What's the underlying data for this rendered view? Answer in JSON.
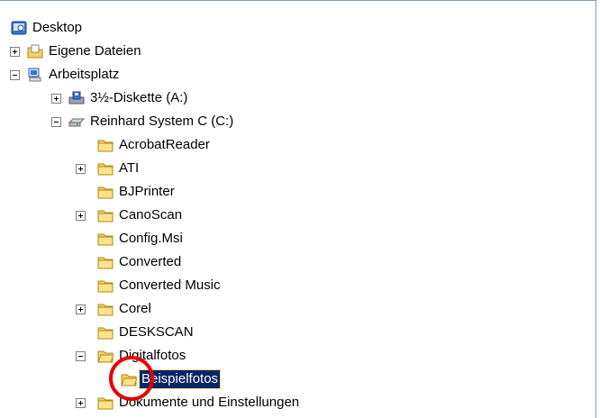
{
  "tree": {
    "desktop": "Desktop",
    "eigene_dateien": "Eigene Dateien",
    "arbeitsplatz": "Arbeitsplatz",
    "diskette": "3½-Diskette (A:)",
    "drive_c": "Reinhard System C (C:)",
    "folders": {
      "acrobat": "AcrobatReader",
      "ati": "ATI",
      "bjprinter": "BJPrinter",
      "canoscan": "CanoScan",
      "configmsi": "Config.Msi",
      "converted": "Converted",
      "converted_music": "Converted Music",
      "corel": "Corel",
      "deskscan": "DESKSCAN",
      "digitalfotos": "Digitalfotos",
      "beispielfotos": "Beispielfotos",
      "dokumente": "Dokumente und Einstellungen"
    }
  },
  "colors": {
    "selection_bg": "#0a246a",
    "folder_yellow": "#f5d35a",
    "highlight_ring": "#e60000"
  }
}
